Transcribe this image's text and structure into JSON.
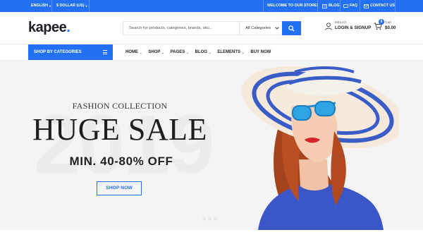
{
  "topbar": {
    "language": "ENGLISH",
    "currency": "$ DOLLAR (US)",
    "welcome": "WELCOME TO OUR STORE!",
    "blog": "BLOG",
    "faq": "FAQ",
    "contact": "CONTACT US"
  },
  "header": {
    "logo_text": "kapee",
    "logo_dot": ".",
    "search_placeholder": "Search for products, categories, brands, sku...",
    "category_select": "All Categories",
    "hello": "HELLO,",
    "login": "LOGIN & SIGNUP",
    "cart_count": "0",
    "cart_label": "Cart",
    "cart_amount": "$0.00"
  },
  "nav": {
    "shop_by_categories": "SHOP BY CATEGORIES",
    "items": [
      {
        "label": "HOME"
      },
      {
        "label": "SHOP"
      },
      {
        "label": "PAGES"
      },
      {
        "label": "BLOG"
      },
      {
        "label": "ELEMENTS"
      },
      {
        "label": "BUY NOW"
      }
    ]
  },
  "hero": {
    "background_year": "2019",
    "kicker": "FASHION COLLECTION",
    "title": "HUGE SALE",
    "subtitle": "MIN. 40-80% OFF",
    "cta": "SHOP NOW"
  },
  "colors": {
    "accent": "#2370f4",
    "hero_bg": "#f4f4f4"
  }
}
